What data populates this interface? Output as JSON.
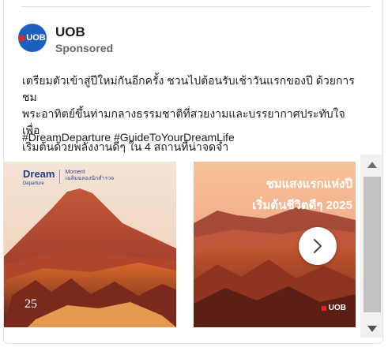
{
  "post": {
    "advertiser": "UOB",
    "avatar_label": "UOB",
    "sponsored_label": "Sponsored",
    "body_line1": "เตรียมตัวเข้าสู่ปีใหม่กันอีกครั้ง ชวนไปต้อนรับเช้าวันแรกของปี ด้วยการชม",
    "body_line2": "พระอาทิตย์ขึ้นท่ามกลางธรรมชาติที่สวยงามและบรรยากาศประทับใจ เพื่อ",
    "body_line3": "เริ่มต้นด้วยพลังงานดีๆ ใน 4 สถานที่น่าจดจำ",
    "hashtags": "#DreamDeparture #GuideToYourDreamLife"
  },
  "carousel": {
    "slides": [
      {
        "logo_main": "Dream",
        "logo_sub": "Departure",
        "logo_side_line1": "Moment",
        "logo_side_line2": "เฉลิมฉลองนักสำรวจ",
        "number": "25"
      },
      {
        "title_line1": "ชมแสงแรกแห่งปี",
        "title_line2": "เริ่มต้นชีวิตดีๆ 2025",
        "brand": "UOB"
      }
    ],
    "next_icon": "chevron-right-icon"
  },
  "scrollbar": {
    "up_icon": "triangle-up-icon",
    "down_icon": "triangle-down-icon"
  },
  "colors": {
    "brand_blue": "#1d5fbf",
    "brand_red": "#e52420"
  }
}
